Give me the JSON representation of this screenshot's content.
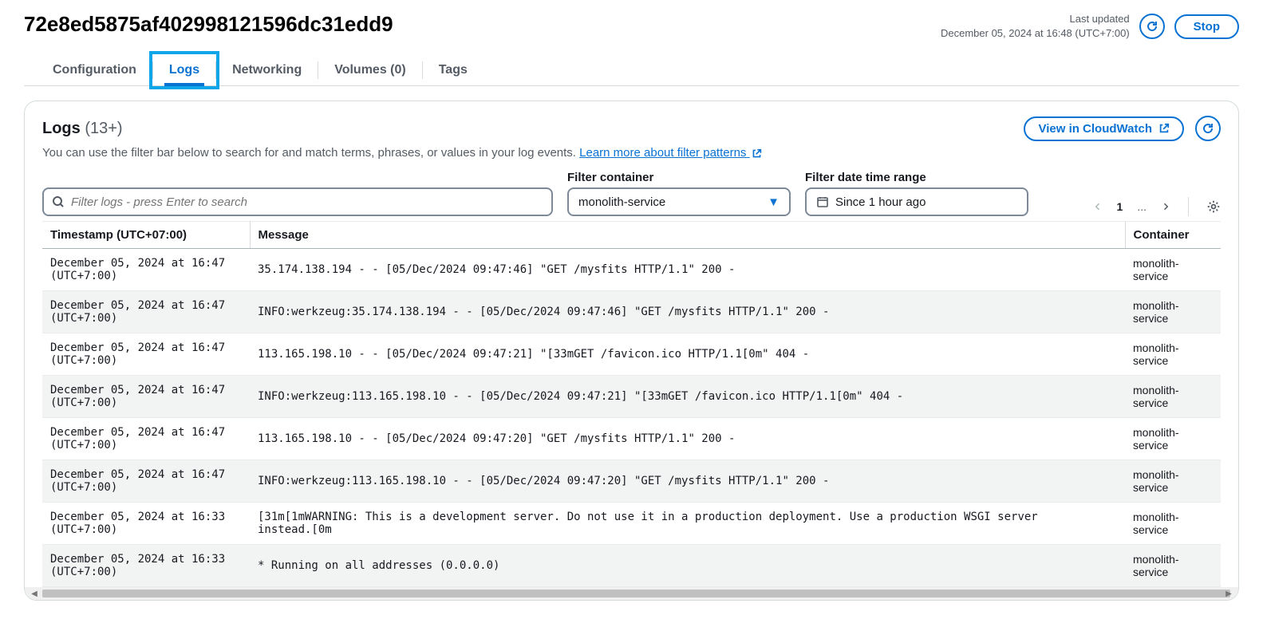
{
  "header": {
    "title": "72e8ed5875af402998121596dc31edd9",
    "last_updated_label": "Last updated",
    "last_updated_value": "December 05, 2024 at 16:48 (UTC+7:00)",
    "stop_label": "Stop"
  },
  "tabs": {
    "configuration": "Configuration",
    "logs": "Logs",
    "networking": "Networking",
    "volumes": "Volumes (0)",
    "tags": "Tags"
  },
  "panel": {
    "title": "Logs",
    "count": "(13+)",
    "desc_text": "You can use the filter bar below to search for and match terms, phrases, or values in your log events. ",
    "desc_link": "Learn more about filter patterns",
    "cloudwatch_label": "View in CloudWatch"
  },
  "filter": {
    "search_placeholder": "Filter logs - press Enter to search",
    "container_label": "Filter container",
    "container_value": "monolith-service",
    "date_label": "Filter date time range",
    "date_value": "Since 1 hour ago"
  },
  "pager": {
    "page": "1",
    "ellipsis": "..."
  },
  "columns": {
    "timestamp": "Timestamp (UTC+07:00)",
    "message": "Message",
    "container": "Container"
  },
  "rows": [
    {
      "ts": "December 05, 2024 at 16:47 (UTC+7:00)",
      "msg": "35.174.138.194 - - [05/Dec/2024 09:47:46] \"GET /mysfits HTTP/1.1\" 200 -",
      "container": "monolith-service"
    },
    {
      "ts": "December 05, 2024 at 16:47 (UTC+7:00)",
      "msg": "INFO:werkzeug:35.174.138.194 - - [05/Dec/2024 09:47:46] \"GET /mysfits HTTP/1.1\" 200 -",
      "container": "monolith-service"
    },
    {
      "ts": "December 05, 2024 at 16:47 (UTC+7:00)",
      "msg": "113.165.198.10 - - [05/Dec/2024 09:47:21] \"\u001b[33mGET /favicon.ico HTTP/1.1\u001b[0m\" 404 -",
      "container": "monolith-service"
    },
    {
      "ts": "December 05, 2024 at 16:47 (UTC+7:00)",
      "msg": "INFO:werkzeug:113.165.198.10 - - [05/Dec/2024 09:47:21] \"\u001b[33mGET /favicon.ico HTTP/1.1\u001b[0m\" 404 -",
      "container": "monolith-service"
    },
    {
      "ts": "December 05, 2024 at 16:47 (UTC+7:00)",
      "msg": "113.165.198.10 - - [05/Dec/2024 09:47:20] \"GET /mysfits HTTP/1.1\" 200 -",
      "container": "monolith-service"
    },
    {
      "ts": "December 05, 2024 at 16:47 (UTC+7:00)",
      "msg": "INFO:werkzeug:113.165.198.10 - - [05/Dec/2024 09:47:20] \"GET /mysfits HTTP/1.1\" 200 -",
      "container": "monolith-service"
    },
    {
      "ts": "December 05, 2024 at 16:33 (UTC+7:00)",
      "msg": "\u001b[31m\u001b[1mWARNING: This is a development server. Do not use it in a production deployment. Use a production WSGI server instead.\u001b[0m",
      "container": "monolith-service"
    },
    {
      "ts": "December 05, 2024 at 16:33 (UTC+7:00)",
      "msg": " * Running on all addresses (0.0.0.0)",
      "container": "monolith-service"
    }
  ]
}
